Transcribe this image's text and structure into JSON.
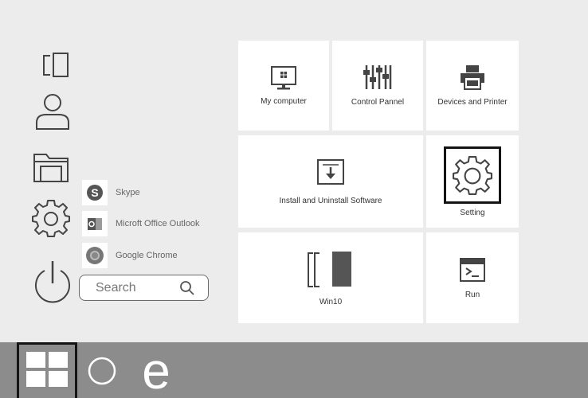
{
  "left_rail": {
    "icons": [
      "tablet-mode-icon",
      "user-icon",
      "file-explorer-icon",
      "settings-gear-icon",
      "power-icon"
    ]
  },
  "apps": [
    {
      "label": "Skype",
      "icon": "skype-icon"
    },
    {
      "label": "Microft Office Outlook",
      "icon": "outlook-icon"
    },
    {
      "label": "Google Chrome",
      "icon": "chrome-icon"
    }
  ],
  "search": {
    "placeholder": "Search",
    "icon": "search-icon"
  },
  "tiles": {
    "my_computer": "My computer",
    "control_panel": "Control Pannel",
    "devices_printer": "Devices and Printer",
    "install_uninstall": "Install and Uninstall Software",
    "setting": "Setting",
    "win10": "Win10",
    "run": "Run"
  },
  "taskbar": {
    "icons": [
      "windows-logo-icon",
      "cortana-circle-icon",
      "edge-e-icon"
    ]
  },
  "colors": {
    "background": "#ececec",
    "tile": "#ffffff",
    "taskbar": "#8c8c8c",
    "highlight_border": "#141414"
  }
}
